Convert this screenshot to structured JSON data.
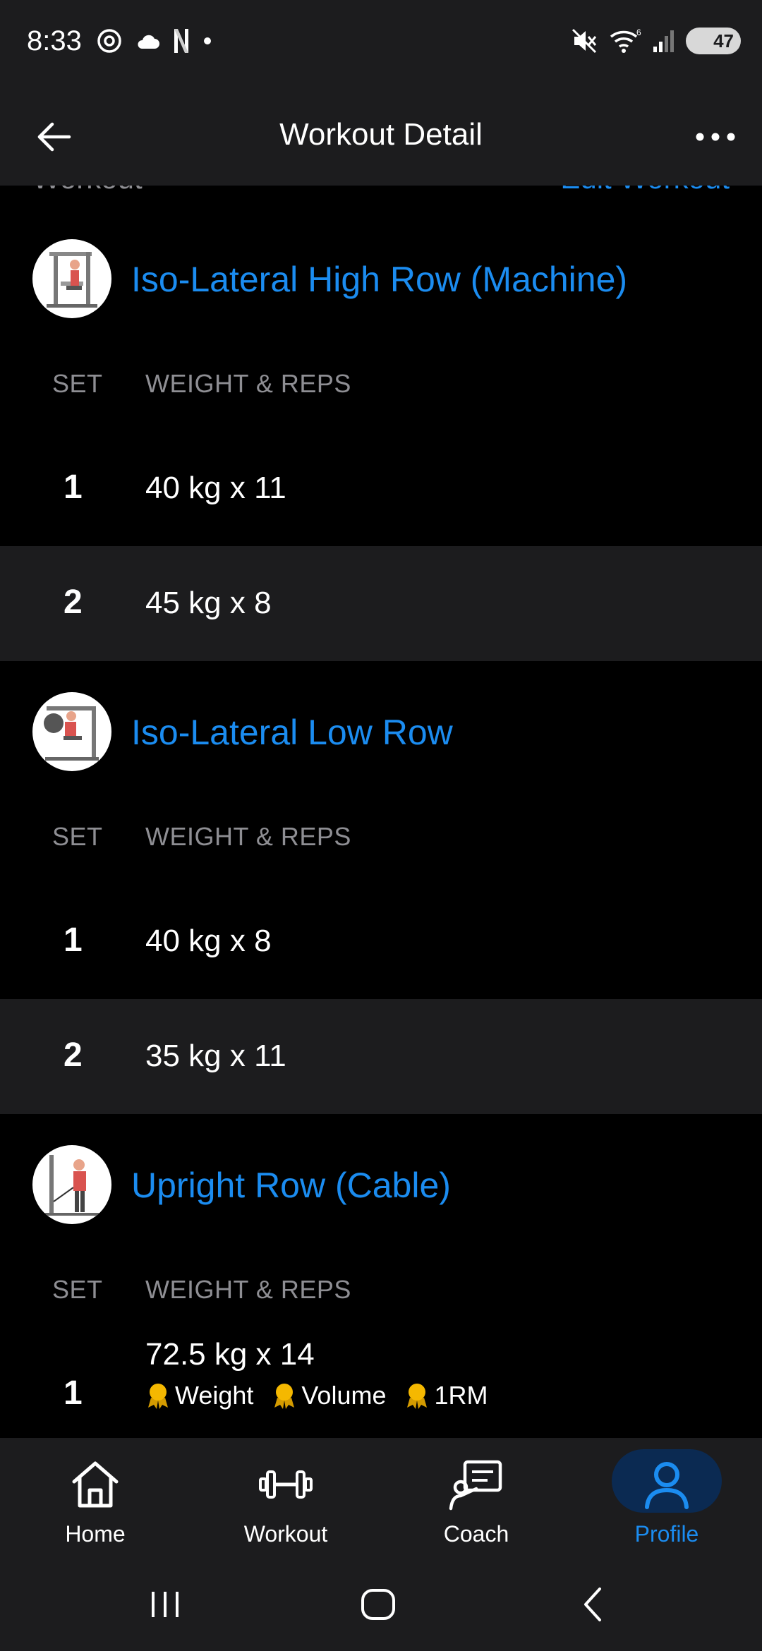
{
  "status_bar": {
    "time": "8:33",
    "battery": "47",
    "network": "6"
  },
  "app_bar": {
    "title": "Workout Detail"
  },
  "partial_header": {
    "left_text": "Workout",
    "right_text": "Edit Workout"
  },
  "exercises": [
    {
      "name": "Iso-Lateral High Row (Machine)",
      "col_set": "SET",
      "col_weight_reps": "WEIGHT & REPS",
      "sets": [
        {
          "num": "1",
          "value": "40 kg x 11"
        },
        {
          "num": "2",
          "value": "45 kg x 8"
        }
      ]
    },
    {
      "name": "Iso-Lateral Low Row",
      "col_set": "SET",
      "col_weight_reps": "WEIGHT & REPS",
      "sets": [
        {
          "num": "1",
          "value": "40 kg x 8"
        },
        {
          "num": "2",
          "value": "35 kg x 11"
        }
      ]
    },
    {
      "name": "Upright Row (Cable)",
      "col_set": "SET",
      "col_weight_reps": "WEIGHT & REPS",
      "sets": [
        {
          "num": "1",
          "value": "72.5 kg x 14",
          "records": [
            "Weight",
            "Volume",
            "1RM"
          ]
        }
      ]
    }
  ],
  "bottom_nav": {
    "items": [
      {
        "label": "Home",
        "icon": "home-icon"
      },
      {
        "label": "Workout",
        "icon": "dumbbell-icon"
      },
      {
        "label": "Coach",
        "icon": "coach-icon"
      },
      {
        "label": "Profile",
        "icon": "profile-icon",
        "active": true
      }
    ]
  },
  "colors": {
    "accent": "#1b8cf0",
    "surface": "#1c1c1e",
    "background": "#000000",
    "muted": "#8e8e93",
    "medal": "#f5b800"
  }
}
